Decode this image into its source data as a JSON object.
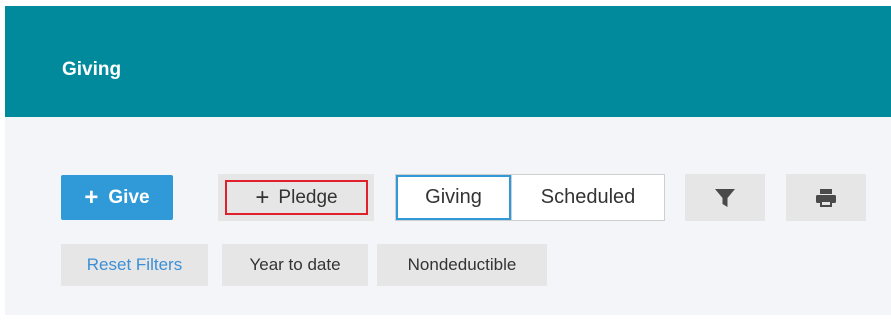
{
  "header": {
    "title": "Giving"
  },
  "toolbar": {
    "give_button": {
      "plus": "+",
      "label": "Give"
    },
    "pledge_button": {
      "plus": "+",
      "label": "Pledge"
    },
    "view_toggle": {
      "giving_label": "Giving",
      "scheduled_label": "Scheduled",
      "selected": "Giving"
    },
    "filter_icon": "filter-icon",
    "print_icon": "print-icon"
  },
  "filters": {
    "reset_label": "Reset Filters",
    "chips": [
      "Year to date",
      "Nondeductible"
    ]
  },
  "colors": {
    "header_bg": "#008a9c",
    "primary": "#2f9ad7",
    "highlight_border": "#e0202c",
    "link": "#3b8fd6"
  }
}
